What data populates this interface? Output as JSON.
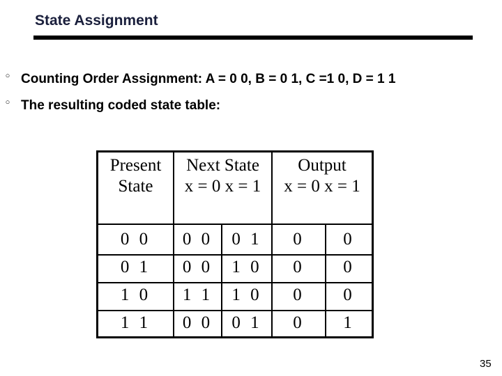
{
  "slide": {
    "title": "State Assignment",
    "bullets": [
      {
        "marker": "○",
        "text": "Counting Order Assignment: A = 0 0, B = 0 1, C =1 0, D = 1 1"
      },
      {
        "marker": "○",
        "text": "The resulting coded state table:"
      }
    ],
    "page_number": "35"
  },
  "table": {
    "headers": {
      "present_line1": "Present",
      "present_line2": "State",
      "next_line1": "Next State",
      "next_line2": "x = 0 x = 1",
      "output_line1": "Output",
      "output_line2": "x = 0 x = 1"
    },
    "rows": [
      {
        "present": "0 0",
        "next_x0": "0 0",
        "next_x1": "0 1",
        "out_x0": "0",
        "out_x1": "0"
      },
      {
        "present": "0 1",
        "next_x0": "0 0",
        "next_x1": "1 0",
        "out_x0": "0",
        "out_x1": "0"
      },
      {
        "present": "1 0",
        "next_x0": "1 1",
        "next_x1": "1 0",
        "out_x0": "0",
        "out_x1": "0"
      },
      {
        "present": "1 1",
        "next_x0": "0 0",
        "next_x1": "0 1",
        "out_x0": "0",
        "out_x1": "1"
      }
    ]
  }
}
